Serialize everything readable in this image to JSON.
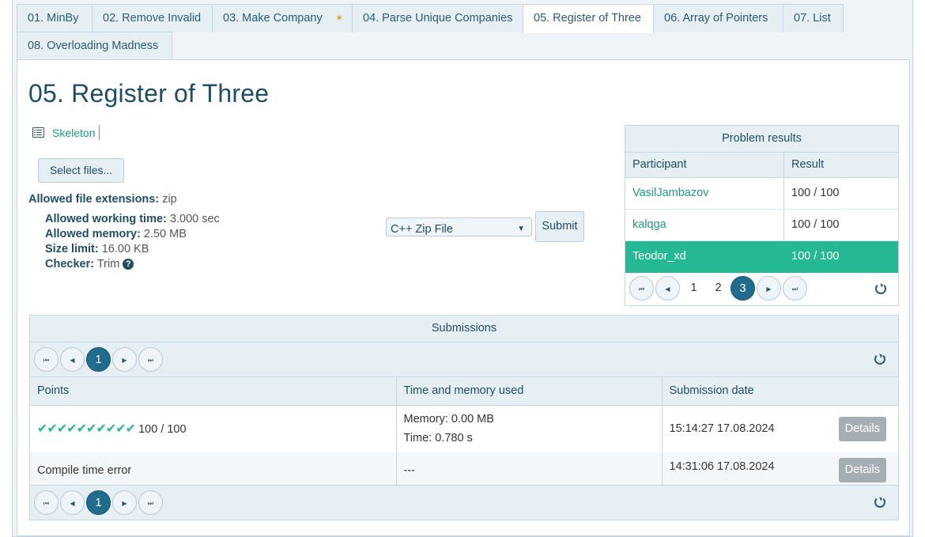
{
  "tabs": [
    {
      "label": "01. MinBy",
      "active": false
    },
    {
      "label": "02. Remove Invalid",
      "active": false
    },
    {
      "label": "03. Make Company",
      "active": false,
      "starred": true
    },
    {
      "label": "04. Parse Unique Companies",
      "active": false
    },
    {
      "label": "05. Register of Three",
      "active": true
    },
    {
      "label": "06. Array of Pointers",
      "active": false
    },
    {
      "label": "07. List",
      "active": false
    },
    {
      "label": "08. Overloading Madness",
      "active": false
    }
  ],
  "star_glyph": "✶",
  "problem": {
    "title": "05. Register of Three",
    "skeleton_label": "Skeleton",
    "select_files_label": "Select files...",
    "allowed_ext_label": "Allowed file extensions:",
    "allowed_ext_value": "zip",
    "working_time_label": "Allowed working time:",
    "working_time_value": "3.000 sec",
    "memory_label": "Allowed memory:",
    "memory_value": "2.50 MB",
    "size_label": "Size limit:",
    "size_value": "16.00 KB",
    "checker_label": "Checker:",
    "checker_value": "Trim",
    "help_glyph": "?"
  },
  "submit_form": {
    "language": "C++ Zip File",
    "submit_label": "Submit"
  },
  "results": {
    "header": "Problem results",
    "col_participant": "Participant",
    "col_result": "Result",
    "rows": [
      {
        "participant": "VasilJambazov",
        "result": "100 / 100"
      },
      {
        "participant": "kalqga",
        "result": "100 / 100"
      },
      {
        "participant": "Teodor_xd",
        "result": "100 / 100"
      }
    ],
    "pages": [
      "1",
      "2",
      "3"
    ],
    "current_page": "3"
  },
  "submissions": {
    "header": "Submissions",
    "col_points": "Points",
    "col_time_memory": "Time and memory used",
    "col_date": "Submission date",
    "page": "1",
    "rows": [
      {
        "checks": "✔✔✔✔✔✔✔✔✔✔",
        "points": "100 / 100",
        "memory": "Memory: 0.00 MB",
        "time": "Time: 0.780 s",
        "date": "15:14:27 17.08.2024",
        "details_label": "Details"
      },
      {
        "points": "Compile time error",
        "time_memory": "---",
        "date": "14:31:06 17.08.2024",
        "details_label": "Details"
      }
    ]
  },
  "pager_glyphs": {
    "first": "⏮",
    "prev": "◀",
    "next": "▶",
    "last": "⏭"
  }
}
